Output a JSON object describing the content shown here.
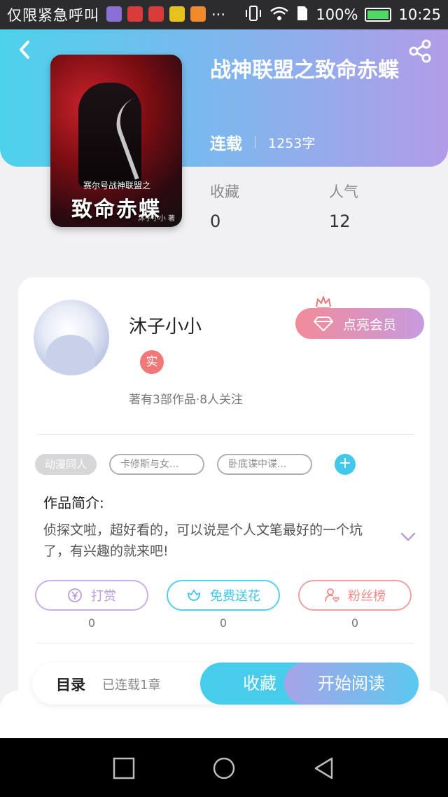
{
  "status_bar": {
    "carrier": "仅限紧急呼叫",
    "battery": "100%",
    "time": "10:25",
    "more": "···"
  },
  "book": {
    "title": "战神联盟之致命赤蝶",
    "status": "连载",
    "word_count": "1253字",
    "cover_title": "致命赤蝶",
    "cover_subtitle": "赛尔号战神联盟之",
    "cover_author": "沐子小小 著",
    "stats": [
      {
        "label": "收藏",
        "value": "0"
      },
      {
        "label": "人气",
        "value": "12"
      }
    ]
  },
  "author": {
    "name": "沐子小小",
    "badge": "实",
    "summary": "著有3部作品·8人关注",
    "vip_label": "点亮会员"
  },
  "tags": {
    "main": "动漫同人",
    "items": [
      "卡修斯与女...",
      "卧底谍中谍..."
    ],
    "add": "+"
  },
  "intro": {
    "title": "作品简介:",
    "text": "侦探文啦，超好看的，可以说是个人文笔最好的一个坑了，有兴趣的就来吧!"
  },
  "actions": [
    {
      "label": "打赏",
      "count": "0",
      "color": "#b99be0"
    },
    {
      "label": "免费送花",
      "count": "0",
      "color": "#3cc7ec"
    },
    {
      "label": "粉丝榜",
      "count": "0",
      "color": "#f08a8a"
    }
  ],
  "bottom": {
    "toc_label": "目录",
    "toc_count": "已连载1章",
    "favorite": "收藏",
    "start_reading": "开始阅读"
  },
  "icons": {
    "back": "back-icon",
    "share": "share-icon",
    "vip": "diamond-icon",
    "crown": "crown-icon",
    "expand": "chevron-down-icon"
  }
}
